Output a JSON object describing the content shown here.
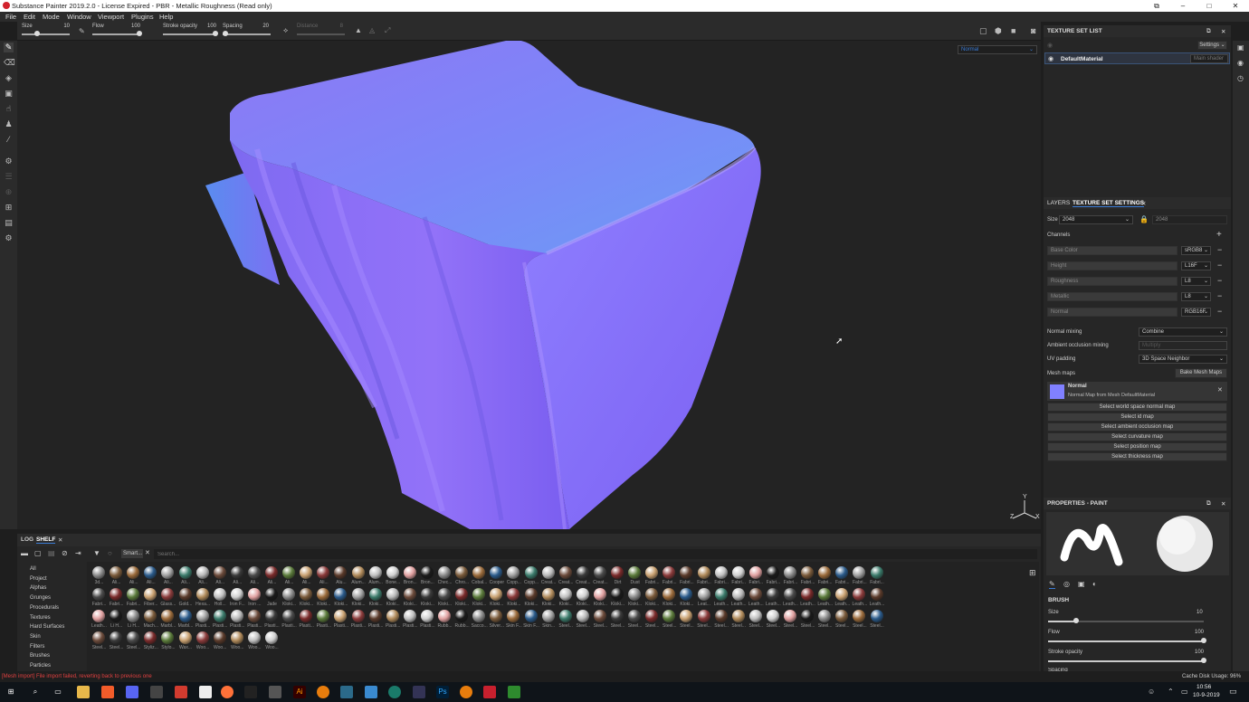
{
  "window": {
    "title": "Substance Painter 2019.2.0 - License Expired - PBR - Metallic Roughness (Read only)"
  },
  "menu": [
    "File",
    "Edit",
    "Mode",
    "Window",
    "Viewport",
    "Plugins",
    "Help"
  ],
  "tool_options": {
    "size_label": "Size",
    "size_value": "10",
    "flow_label": "Flow",
    "flow_value": "100",
    "stroke_opacity_label": "Stroke opacity",
    "stroke_opacity_value": "100",
    "spacing_label": "Spacing",
    "spacing_value": "20",
    "distance_label": "Distance",
    "distance_value": "8"
  },
  "viewport": {
    "channel_dropdown": "Normal",
    "axis_y": "Y",
    "axis_z": "Z",
    "axis_x": "X"
  },
  "texture_set_list": {
    "title": "TEXTURE SET LIST",
    "settings_button": "Settings",
    "material": "DefaultMaterial",
    "shader": "Main shader"
  },
  "texture_set_settings": {
    "tab_layers": "LAYERS",
    "tab_tss": "TEXTURE SET SETTINGS",
    "size_label": "Size",
    "size_value": "2048",
    "size_value2": "2048",
    "channels_label": "Channels",
    "channels": [
      {
        "name": "Base Color",
        "format": "sRGB8"
      },
      {
        "name": "Height",
        "format": "L16F"
      },
      {
        "name": "Roughness",
        "format": "L8"
      },
      {
        "name": "Metallic",
        "format": "L8"
      },
      {
        "name": "Normal",
        "format": "RGB16F"
      }
    ],
    "normal_mixing_label": "Normal mixing",
    "normal_mixing_value": "Combine",
    "ao_mixing_label": "Ambient occlusion mixing",
    "ao_mixing_value": "Multiply",
    "uv_padding_label": "UV padding",
    "uv_padding_value": "3D Space Neighbor",
    "mesh_maps_label": "Mesh maps",
    "bake_button": "Bake Mesh Maps",
    "normal_map_title": "Normal",
    "normal_map_desc": "Normal Map from Mesh DefaultMaterial",
    "select_buttons": [
      "Select world space normal map",
      "Select id map",
      "Select ambient occlusion map",
      "Select curvature map",
      "Select position map",
      "Select thickness map"
    ]
  },
  "properties": {
    "title": "PROPERTIES - PAINT",
    "brush_label": "BRUSH",
    "size_label": "Size",
    "size_value": "10",
    "size_level": 0.18,
    "flow_label": "Flow",
    "flow_value": "100",
    "flow_level": 1.0,
    "stroke_opacity_label": "Stroke opacity",
    "stroke_opacity_value": "100",
    "stroke_opacity_level": 1.0,
    "spacing_label": "Spacing"
  },
  "shelf": {
    "tab_log": "LOG",
    "tab_shelf": "SHELF",
    "filter_chip": "Smart...",
    "search_placeholder": "Search...",
    "categories": [
      "All",
      "Project",
      "Alphas",
      "Grunges",
      "Procedurals",
      "Textures",
      "Hard Surfaces",
      "Skin",
      "Filters",
      "Brushes",
      "Particles"
    ],
    "rows": [
      [
        "3d...",
        "Ali...",
        "Ali...",
        "Ali...",
        "Ali...",
        "Ali...",
        "Ali...",
        "Ali...",
        "Ali...",
        "Ali...",
        "Ali...",
        "Ali...",
        "Ali...",
        "Ali...",
        "Alu...",
        "Alum...",
        "Alum...",
        "Bone...",
        "Bron...",
        "Bron...",
        "Chec...",
        "Chro...",
        "Cobal...",
        "Cooper",
        "Copp...",
        "Copp...",
        "Creat...",
        "Creat...",
        "Creat...",
        "Creat...",
        "Dirt",
        "Dust",
        "Fabri...",
        "Fabri...",
        "Fabri...",
        "Fabri...",
        "Fabri...",
        "Fabri...",
        "Fabri...",
        "Fabri...",
        "Fabri...",
        "Fabri...",
        "Fabri...",
        "Fabri...",
        "Fabri...",
        "Fabri..."
      ],
      [
        "Fabri...",
        "Fabri...",
        "Fabri...",
        "Fiber...",
        "Glass...",
        "Gold...",
        "Hexa...",
        "Holl...",
        "Iron F...",
        "Iron ...",
        "Jade",
        "Kloki...",
        "Kloki...",
        "Kloki...",
        "Kloki...",
        "Kloki...",
        "Kloki...",
        "Kloki...",
        "Kloki...",
        "Kloki...",
        "Kloki...",
        "Kloki...",
        "Kloki...",
        "Kloki...",
        "Kloki...",
        "Kloki...",
        "Kloki...",
        "Kloki...",
        "Kloki...",
        "Kloki...",
        "Kloki...",
        "Kloki...",
        "Kloki...",
        "Kloki...",
        "Kloki...",
        "Leat...",
        "Leath...",
        "Leath...",
        "Leath...",
        "Leath...",
        "Leath...",
        "Leath...",
        "Leath...",
        "Leath...",
        "Leath...",
        "Leath..."
      ],
      [
        "Leath...",
        "Li H...",
        "Li H...",
        "Mach...",
        "Marbl...",
        "Marbl...",
        "Plasti...",
        "Plasti...",
        "Plasti...",
        "Plasti...",
        "Plasti...",
        "Plasti...",
        "Plasti...",
        "Plasti...",
        "Plasti...",
        "Plasti...",
        "Plasti...",
        "Plasti...",
        "Plasti...",
        "Plasti...",
        "Rubb...",
        "Rubb...",
        "Sacco...",
        "Silver...",
        "Skin F...",
        "Skin F...",
        "Skin...",
        "Steel...",
        "Steel...",
        "Steel...",
        "Steel...",
        "Steel...",
        "Steel...",
        "Steel...",
        "Steel...",
        "Steel...",
        "Steel...",
        "Steel...",
        "Steel...",
        "Steel...",
        "Steel...",
        "Steel...",
        "Steel...",
        "Steel...",
        "Steel...",
        "Steel..."
      ],
      [
        "Steel...",
        "Steel...",
        "Steel...",
        "Styliz...",
        "Stylo...",
        "Wax...",
        "Woo...",
        "Woo...",
        "Woo...",
        "Woo...",
        "Woo..."
      ]
    ]
  },
  "status": {
    "error": "[Mesh import] File import failed, reverting back to previous one",
    "cache": "Cache Disk Usage:   96%"
  },
  "taskbar": {
    "time": "10:56",
    "date": "10-9-2019"
  },
  "colors": {
    "accent": "#3a7bd5",
    "error": "#e04040",
    "normal_map": "#8080ff"
  }
}
